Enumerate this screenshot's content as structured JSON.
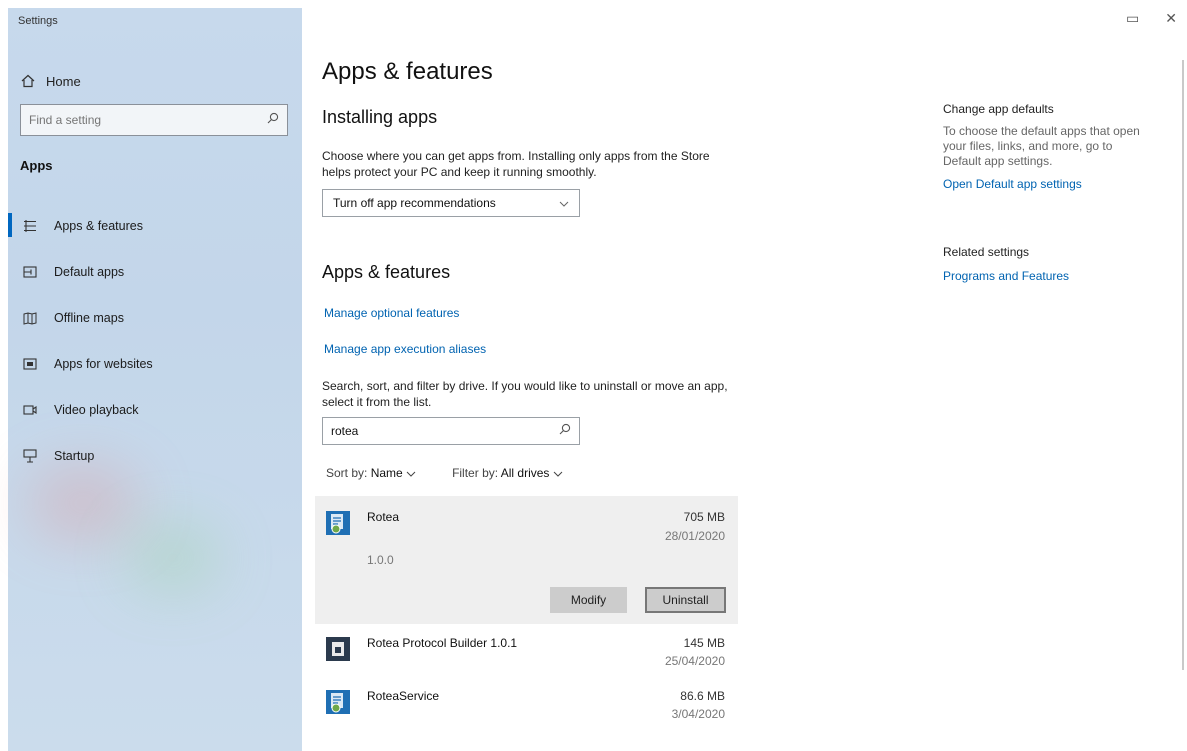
{
  "window": {
    "title": "Settings",
    "controls": [
      "▭",
      "✕"
    ]
  },
  "sidebar": {
    "home_label": "Home",
    "search_placeholder": "Find a setting",
    "section": "Apps",
    "items": [
      {
        "label": "Apps & features",
        "icon": "list-icon",
        "active": true
      },
      {
        "label": "Default apps",
        "icon": "default-apps-icon",
        "active": false
      },
      {
        "label": "Offline maps",
        "icon": "map-icon",
        "active": false
      },
      {
        "label": "Apps for websites",
        "icon": "web-app-icon",
        "active": false
      },
      {
        "label": "Video playback",
        "icon": "video-icon",
        "active": false
      },
      {
        "label": "Startup",
        "icon": "startup-icon",
        "active": false
      }
    ]
  },
  "main": {
    "title": "Apps & features",
    "installing": {
      "heading": "Installing apps",
      "description": "Choose where you can get apps from. Installing only apps from the Store helps protect your PC and keep it running smoothly.",
      "dropdown_value": "Turn off app recommendations"
    },
    "apps_features": {
      "heading": "Apps & features",
      "link_optional": "Manage optional features",
      "link_aliases": "Manage app execution aliases",
      "search_description": "Search, sort, and filter by drive. If you would like to uninstall or move an app, select it from the list.",
      "search_value": "rotea",
      "sort_label": "Sort by:",
      "sort_value": "Name",
      "filter_label": "Filter by:",
      "filter_value": "All drives"
    },
    "apps": [
      {
        "name": "Rotea",
        "size": "705 MB",
        "date": "28/01/2020",
        "version": "1.0.0",
        "selected": true,
        "modify": "Modify",
        "uninstall": "Uninstall"
      },
      {
        "name": "Rotea Protocol Builder 1.0.1",
        "size": "145 MB",
        "date": "25/04/2020",
        "selected": false
      },
      {
        "name": "RoteaService",
        "size": "86.6 MB",
        "date": "3/04/2020",
        "selected": false
      }
    ]
  },
  "right_panel": {
    "defaults_heading": "Change app defaults",
    "defaults_text": "To choose the default apps that open your files, links, and more, go to Default app settings.",
    "defaults_link": "Open Default app settings",
    "related_heading": "Related settings",
    "related_link": "Programs and Features"
  },
  "colors": {
    "accent": "#0063b1",
    "sidebar_bg": "#c7d9ec",
    "selected_row": "#efefef"
  }
}
